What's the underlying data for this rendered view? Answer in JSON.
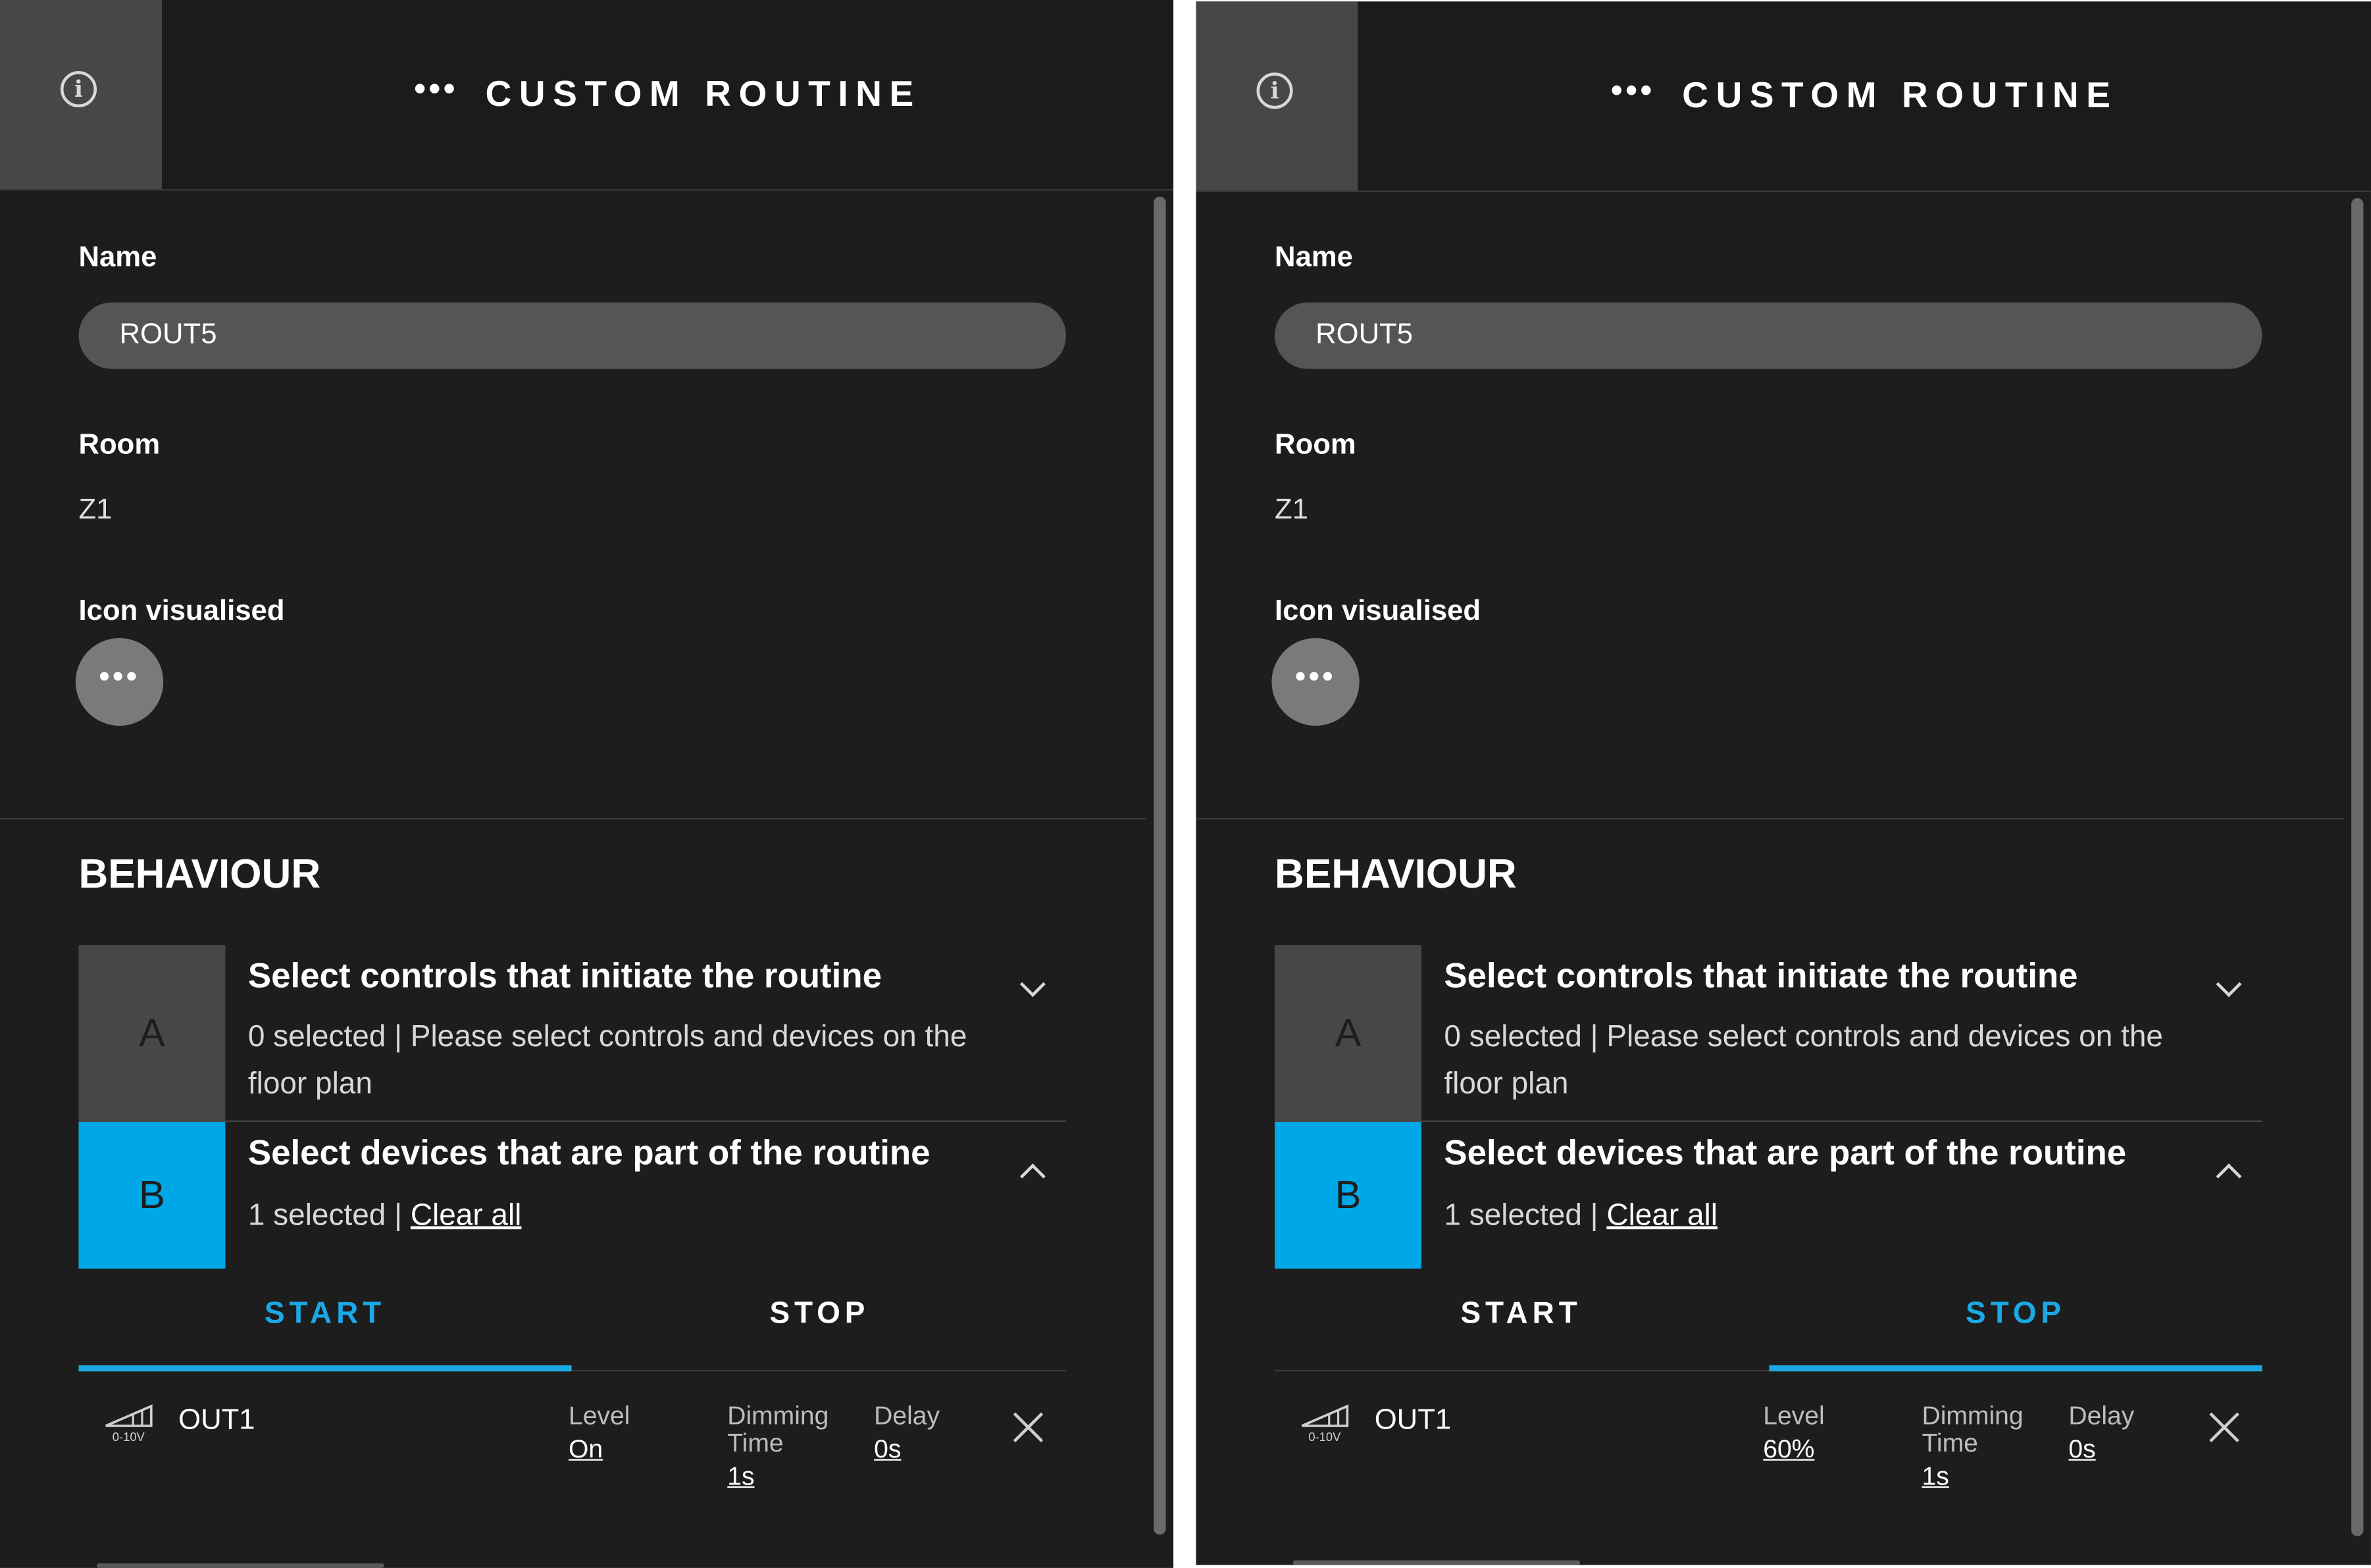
{
  "panels": [
    {
      "header": {
        "dots": "•••",
        "title": "CUSTOM ROUTINE",
        "info_glyph": "i"
      },
      "name": {
        "label": "Name",
        "value": "ROUT5"
      },
      "room": {
        "label": "Room",
        "value": "Z1"
      },
      "icon_visualised": {
        "label": "Icon visualised",
        "glyph": "•••"
      },
      "behaviour": {
        "title": "BEHAVIOUR",
        "step_a": {
          "letter": "A",
          "title": "Select controls that initiate the routine",
          "subtitle": "0 selected | Please select controls and devices on the floor plan"
        },
        "step_b": {
          "letter": "B",
          "title": "Select devices that are part of the routine",
          "selected": "1 selected | ",
          "clear_all": "Clear all"
        }
      },
      "tabs": {
        "start": "START",
        "stop": "STOP",
        "active": "start"
      },
      "device": {
        "icon": "0-10v-dimmer-icon",
        "icon_label": "0-10V",
        "name": "OUT1",
        "level_label": "Level",
        "level_value": "On",
        "dimming_label_1": "Dimming",
        "dimming_label_2": "Time",
        "dimming_value": "1s",
        "delay_label": "Delay",
        "delay_value": "0s"
      }
    },
    {
      "header": {
        "dots": "•••",
        "title": "CUSTOM ROUTINE",
        "info_glyph": "i"
      },
      "name": {
        "label": "Name",
        "value": "ROUT5"
      },
      "room": {
        "label": "Room",
        "value": "Z1"
      },
      "icon_visualised": {
        "label": "Icon visualised",
        "glyph": "•••"
      },
      "behaviour": {
        "title": "BEHAVIOUR",
        "step_a": {
          "letter": "A",
          "title": "Select controls that initiate the routine",
          "subtitle": "0 selected | Please select controls and devices on the floor plan"
        },
        "step_b": {
          "letter": "B",
          "title": "Select devices that are part of the routine",
          "selected": "1 selected | ",
          "clear_all": "Clear all"
        }
      },
      "tabs": {
        "start": "START",
        "stop": "STOP",
        "active": "stop"
      },
      "device": {
        "icon": "0-10v-dimmer-icon",
        "icon_label": "0-10V",
        "name": "OUT1",
        "level_label": "Level",
        "level_value": "60%",
        "dimming_label_1": "Dimming",
        "dimming_label_2": "Time",
        "dimming_value": "1s",
        "delay_label": "Delay",
        "delay_value": "0s"
      }
    }
  ],
  "colors": {
    "accent": "#1ba9e6",
    "step_b": "#00a7e6",
    "panel_bg": "#1d1d1d",
    "input_bg": "#555555"
  }
}
